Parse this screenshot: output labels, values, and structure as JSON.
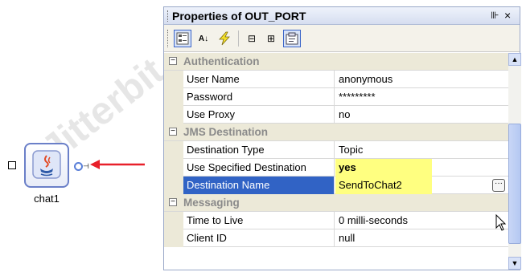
{
  "watermark": "Jitterbit",
  "canvas": {
    "node_label": "chat1"
  },
  "panel": {
    "title": "Properties of OUT_PORT",
    "pin_glyph": "⊪",
    "close_glyph": "×"
  },
  "toolbar": {
    "categorized_icon": "categorized-icon",
    "alphabetical_glyph": "A↓",
    "events_icon": "lightning-icon",
    "collapse_glyph": "⊟",
    "expand_glyph": "⊞",
    "property_pages_icon": "property-pages-icon"
  },
  "properties": {
    "cat_auth": "Authentication",
    "user_name_label": "User Name",
    "user_name_value": "anonymous",
    "password_label": "Password",
    "password_value": "*********",
    "use_proxy_label": "Use Proxy",
    "use_proxy_value": "no",
    "cat_jms": "JMS Destination",
    "dest_type_label": "Destination Type",
    "dest_type_value": "Topic",
    "use_specified_label": "Use Specified Destination",
    "use_specified_value": "yes",
    "dest_name_label": "Destination Name",
    "dest_name_value": "SendToChat2",
    "cat_messaging": "Messaging",
    "ttl_label": "Time to Live",
    "ttl_value": "0 milli-seconds",
    "client_id_label": "Client ID",
    "client_id_value": "null"
  },
  "colors": {
    "selection": "#3163c5",
    "highlight": "#ffff80",
    "arrow": "#e8202a"
  }
}
